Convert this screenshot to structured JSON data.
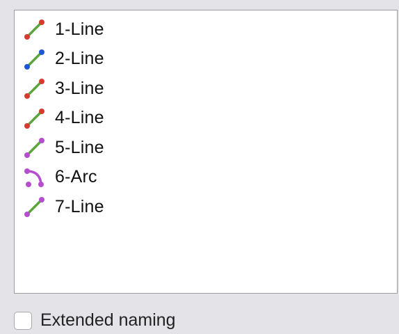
{
  "items": [
    {
      "label": "1-Line",
      "icon": "line-icon",
      "line_color": "#5aa53c",
      "dot_color": "#d83a30"
    },
    {
      "label": "2-Line",
      "icon": "line-icon",
      "line_color": "#5aa53c",
      "dot_color": "#1d56d6"
    },
    {
      "label": "3-Line",
      "icon": "line-icon",
      "line_color": "#5aa53c",
      "dot_color": "#d83a30"
    },
    {
      "label": "4-Line",
      "icon": "line-icon",
      "line_color": "#5aa53c",
      "dot_color": "#d83a30"
    },
    {
      "label": "5-Line",
      "icon": "line-icon",
      "line_color": "#5aa53c",
      "dot_color": "#b54fd0"
    },
    {
      "label": "6-Arc",
      "icon": "arc-icon",
      "line_color": "#b54fd0",
      "dot_color": "#b54fd0"
    },
    {
      "label": "7-Line",
      "icon": "line-icon",
      "line_color": "#5aa53c",
      "dot_color": "#b54fd0"
    }
  ],
  "extended_naming": {
    "label": "Extended naming",
    "checked": false
  }
}
